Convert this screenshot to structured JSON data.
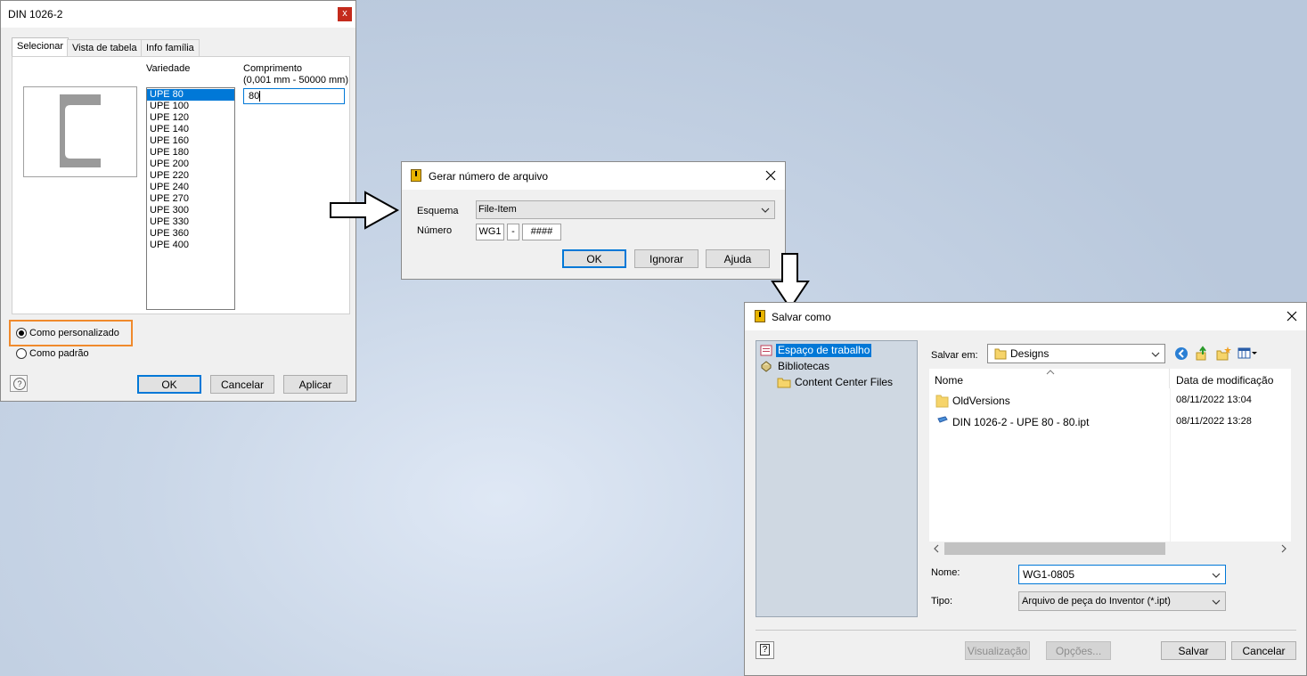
{
  "din_dialog": {
    "title": "DIN 1026-2",
    "close_label": "x",
    "tabs": [
      "Selecionar",
      "Vista de tabela",
      "Info família"
    ],
    "variedade_label": "Variedade",
    "comprimento_label": "Comprimento",
    "comprimento_range": "(0,001 mm - 50000 mm)",
    "comprimento_value": "80",
    "variedades": [
      "UPE 80",
      "UPE 100",
      "UPE 120",
      "UPE 140",
      "UPE 160",
      "UPE 180",
      "UPE 200",
      "UPE 220",
      "UPE 240",
      "UPE 270",
      "UPE 300",
      "UPE 330",
      "UPE 360",
      "UPE 400"
    ],
    "selected_variedade": "UPE 80",
    "radio_custom": "Como personalizado",
    "radio_standard": "Como padrão",
    "help_icon": "?",
    "ok": "OK",
    "cancel": "Cancelar",
    "apply": "Aplicar"
  },
  "gerar_dialog": {
    "title": "Gerar número de arquivo",
    "esquema_label": "Esquema",
    "esquema_value": "File-Item",
    "numero_label": "Número",
    "numero_prefix": "WG1",
    "numero_sep": "-",
    "numero_mask": "####",
    "ok": "OK",
    "ignore": "Ignorar",
    "help": "Ajuda"
  },
  "salvar_dialog": {
    "title": "Salvar como",
    "tree": [
      {
        "label": "Espaço de trabalho",
        "icon": "workspace-icon",
        "selected": true
      },
      {
        "label": "Bibliotecas",
        "icon": "libraries-icon",
        "selected": false
      },
      {
        "label": "Content Center Files",
        "icon": "folder-icon",
        "selected": false
      }
    ],
    "salvar_em_label": "Salvar em:",
    "salvar_em_value": "Designs",
    "col_name": "Nome",
    "col_date": "Data de modificação",
    "files": [
      {
        "name": "OldVersions",
        "date": "08/11/2022 13:04",
        "icon": "folder-icon"
      },
      {
        "name": "DIN 1026-2 - UPE 80 - 80.ipt",
        "date": "08/11/2022 13:28",
        "icon": "part-file-icon"
      }
    ],
    "nome_label": "Nome:",
    "nome_value": "WG1-0805",
    "tipo_label": "Tipo:",
    "tipo_value": "Arquivo de peça do Inventor (*.ipt)",
    "help_icon": "?",
    "preview": "Visualização",
    "options": "Opções...",
    "save": "Salvar",
    "cancel": "Cancelar"
  },
  "colors": {
    "accent": "#0078d7",
    "highlight_box": "#f08a2c"
  }
}
